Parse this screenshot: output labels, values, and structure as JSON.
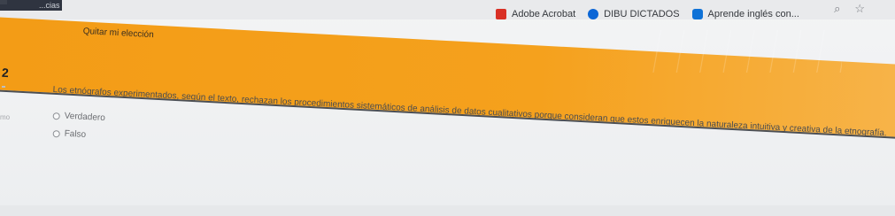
{
  "browser": {
    "tab_partial": "...cias",
    "bookmarks": [
      {
        "label": "Adobe Acrobat",
        "icon": "acrobat-icon"
      },
      {
        "label": "DIBU DICTADOS",
        "icon": "dibu-icon"
      },
      {
        "label": "Aprende inglés con...",
        "icon": "aprende-icon"
      }
    ],
    "toolbar_icons": [
      "zoom-icon",
      "star-icon"
    ]
  },
  "quiz": {
    "clear_choice_label": "Quitar mi elección",
    "question_number": "2",
    "left_edge_text": "mo",
    "question_text": "Los etnógrafos experimentados, según el texto, rechazan los procedimientos sistemáticos de análisis de datos cualitativos porque consideran que estos enriquecen la naturaleza intuitiva y creativa de la etnografía.",
    "options": [
      {
        "label": "Verdadero"
      },
      {
        "label": "Falso"
      }
    ]
  },
  "colors": {
    "band": "#f39c16",
    "text": "#4a4c50"
  }
}
